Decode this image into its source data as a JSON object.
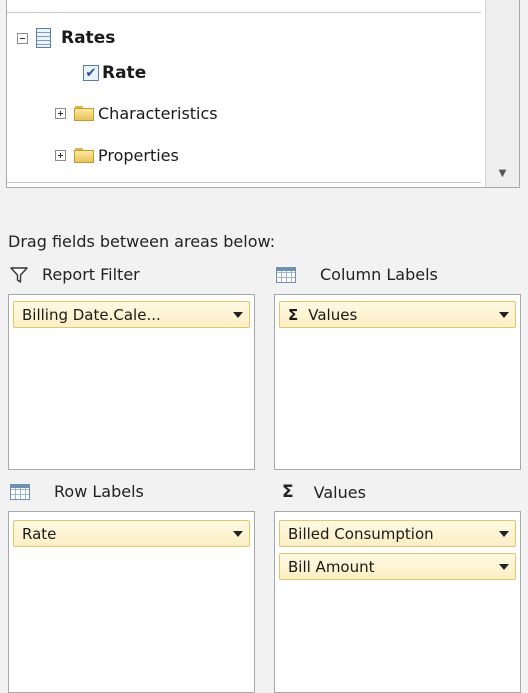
{
  "field_list": {
    "items": [
      {
        "label": "Rates",
        "icon": "table-icon",
        "expanded": true
      },
      {
        "label": "Rate",
        "icon": "checkbox-icon",
        "checked": true
      },
      {
        "label": "Characteristics",
        "icon": "folder-icon",
        "expanded": false
      },
      {
        "label": "Properties",
        "icon": "folder-icon",
        "expanded": false
      }
    ]
  },
  "areas": {
    "instruction": "Drag fields between areas below:",
    "report_filter": {
      "title": "Report Filter",
      "icon": "filter-icon",
      "fields": [
        "Billing Date.Cale..."
      ]
    },
    "column_labels": {
      "title": "Column Labels",
      "icon": "grid-icon",
      "fields": [
        "Values"
      ]
    },
    "row_labels": {
      "title": "Row Labels",
      "icon": "grid-icon",
      "fields": [
        "Rate"
      ]
    },
    "values": {
      "title": "Values",
      "icon": "sigma-icon",
      "fields": [
        "Billed Consumption",
        "Bill Amount"
      ]
    }
  },
  "colors": {
    "chip_background": "#fcefc4",
    "chip_border": "#e4c66a",
    "panel_background": "#f2f2f2"
  }
}
